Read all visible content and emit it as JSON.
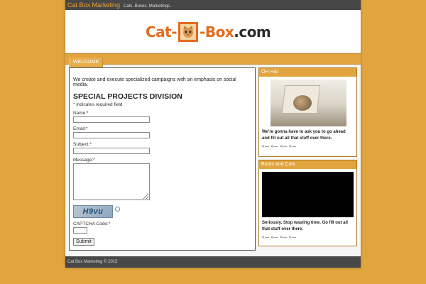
{
  "topbar": {
    "site_name": "Cat Box Marketing",
    "tagline": "Cats. Boxes. Marketings."
  },
  "logo": {
    "part1": "Cat-",
    "part2": "-Box",
    "part3": ".com",
    "icon": "cat-face-icon"
  },
  "nav": {
    "items": [
      {
        "label": "WELCOME"
      }
    ]
  },
  "main": {
    "intro": "We create and execute specialized campaigns with an emphasis on social media.",
    "form_title": "SPECIAL PROJECTS DIVISION",
    "required_note": "* indicates required field",
    "fields": {
      "name_label": "Name:*",
      "email_label": "Email:*",
      "subject_label": "Subject:*",
      "message_label": "Message:*",
      "captcha_label": "CAPTCHA Code:*"
    },
    "captcha_text": "H9vu",
    "submit_label": "Submit"
  },
  "sidebar": {
    "widget1": {
      "title": "OH HAI",
      "text": "We're gonna have to ask you to go ahead and fill out all that stuff over there.",
      "arrows": "<— <— <— <—"
    },
    "widget2": {
      "title": "Boots and Cats",
      "text": "Seriously. Stop wasting time. Go fill out all that stuff over there.",
      "arrows": "<— <— <— <—"
    }
  },
  "footer": {
    "text": "Cat Box Marketing © 2015"
  },
  "colors": {
    "background": "#e2a43f",
    "bar": "#474747",
    "logo_orange": "#e36b1d"
  }
}
